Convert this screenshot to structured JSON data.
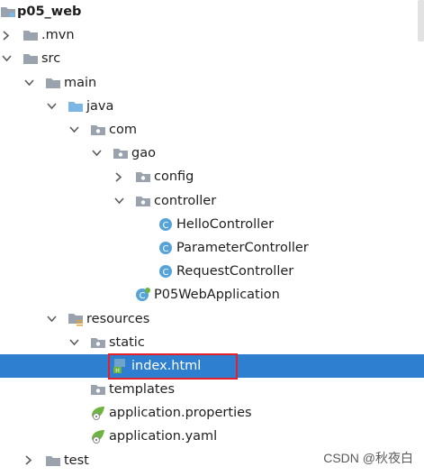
{
  "tree": [
    {
      "label": "p05_web",
      "icon": "module-folder-icon",
      "arrow": "none",
      "depth": 0,
      "root": true
    },
    {
      "label": ".mvn",
      "icon": "folder-icon",
      "arrow": "collapsed",
      "depth": 0
    },
    {
      "label": "src",
      "icon": "folder-icon",
      "arrow": "expanded",
      "depth": 0
    },
    {
      "label": "main",
      "icon": "folder-icon",
      "arrow": "expanded",
      "depth": 1
    },
    {
      "label": "java",
      "icon": "source-folder-icon",
      "arrow": "expanded",
      "depth": 2
    },
    {
      "label": "com",
      "icon": "package-icon",
      "arrow": "expanded",
      "depth": 3
    },
    {
      "label": "gao",
      "icon": "package-icon",
      "arrow": "expanded",
      "depth": 4
    },
    {
      "label": "config",
      "icon": "package-icon",
      "arrow": "collapsed",
      "depth": 5
    },
    {
      "label": "controller",
      "icon": "package-icon",
      "arrow": "expanded",
      "depth": 5
    },
    {
      "label": "HelloController",
      "icon": "java-class-icon",
      "arrow": "none",
      "depth": 6
    },
    {
      "label": "ParameterController",
      "icon": "java-class-icon",
      "arrow": "none",
      "depth": 6
    },
    {
      "label": "RequestController",
      "icon": "java-class-icon",
      "arrow": "none",
      "depth": 6
    },
    {
      "label": "P05WebApplication",
      "icon": "spring-boot-class-icon",
      "arrow": "none",
      "depth": 5
    },
    {
      "label": "resources",
      "icon": "resources-folder-icon",
      "arrow": "expanded",
      "depth": 2
    },
    {
      "label": "static",
      "icon": "package-icon",
      "arrow": "expanded",
      "depth": 3
    },
    {
      "label": "index.html",
      "icon": "html-file-icon",
      "arrow": "none",
      "depth": 4,
      "selected": true
    },
    {
      "label": "templates",
      "icon": "package-icon",
      "arrow": "none",
      "depth": 3
    },
    {
      "label": "application.properties",
      "icon": "spring-config-icon",
      "arrow": "none",
      "depth": 3
    },
    {
      "label": "application.yaml",
      "icon": "spring-config-icon",
      "arrow": "none",
      "depth": 3
    },
    {
      "label": "test",
      "icon": "folder-icon",
      "arrow": "collapsed",
      "depth": 1
    }
  ],
  "colors": {
    "selection": "#2f7fd1",
    "highlight_border": "#e6202a",
    "folder": "#9aa3ad",
    "source_folder": "#7cb6e3",
    "java_class": "#56a3d9",
    "spring": "#6db33f"
  },
  "watermark": "CSDN @秋夜白"
}
